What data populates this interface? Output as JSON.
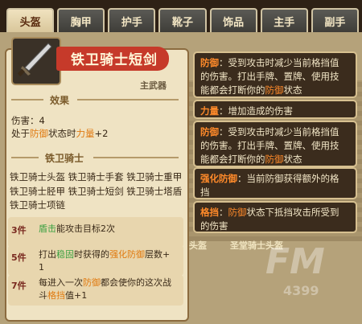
{
  "tabs": [
    {
      "label": "头盔",
      "active": true
    },
    {
      "label": "胸甲",
      "active": false
    },
    {
      "label": "护手",
      "active": false
    },
    {
      "label": "靴子",
      "active": false
    },
    {
      "label": "饰品",
      "active": false
    },
    {
      "label": "主手",
      "active": false
    },
    {
      "label": "副手",
      "active": false
    }
  ],
  "item": {
    "name": "铁卫骑士短剑",
    "slot": "主武器",
    "effect_header": "效果",
    "stat_line1": "伤害：4",
    "stat_prefix": "处于",
    "stat_kw1": "防御",
    "stat_mid": "状态时",
    "stat_kw2": "力量",
    "stat_value": "+2"
  },
  "set": {
    "header": "铁卫骑士",
    "items_line1": "铁卫骑士头盔 铁卫骑士手套 铁卫骑士重甲",
    "items_line2": "铁卫骑士胫甲 铁卫骑士短剑 铁卫骑士塔盾",
    "items_line3": "铁卫骑士项链",
    "bonus3_tier": "3件",
    "bonus3_kw": "盾击",
    "bonus3_text": "能攻击目标2次",
    "bonus5_tier": "5件",
    "bonus5_pre": "打出",
    "bonus5_kw1": "稳固",
    "bonus5_mid": "时获得的",
    "bonus5_kw2": "强化防御",
    "bonus5_post": "层数+",
    "bonus5_line2": "1",
    "bonus7_tier": "7件",
    "bonus7_pre": "每进入一次",
    "bonus7_kw1": "防御",
    "bonus7_mid": "都会使你的这次战",
    "bonus7_l2pre": "斗",
    "bonus7_kw2": "格挡",
    "bonus7_l2post": "值+1"
  },
  "tips": {
    "defense1_kw": "防御",
    "defense1_text1": "：受到攻击时减少当前格挡值",
    "defense1_text2": "的伤害。打出手牌、置牌、使用技",
    "defense1_text3": "能都会打断你的",
    "defense1_kw2": "防御",
    "defense1_text4": "状态",
    "strength_kw": "力量",
    "strength_text": "：增加造成的伤害",
    "defense2_kw": "防御",
    "defense2_text1": "：受到攻击时减少当前格挡值",
    "defense2_text2": "的伤害。打出手牌、置牌、使用技",
    "defense2_text3": "能都会打断你的",
    "defense2_kw2": "防御",
    "defense2_text4": "状态",
    "enhance_kw": "强化防御",
    "enhance_text1": "：当前防御获得额外的格",
    "enhance_text2": "挡",
    "block_kw": "格挡",
    "block_pre": "：",
    "block_kw2": "防御",
    "block_text1": "状态下抵挡攻击所受到",
    "block_text2": "的伤害"
  },
  "background": {
    "label_helmet": "头盔",
    "label_holy": "圣堂骑士头盔",
    "watermark": "FM",
    "watermark_num": "4399"
  }
}
